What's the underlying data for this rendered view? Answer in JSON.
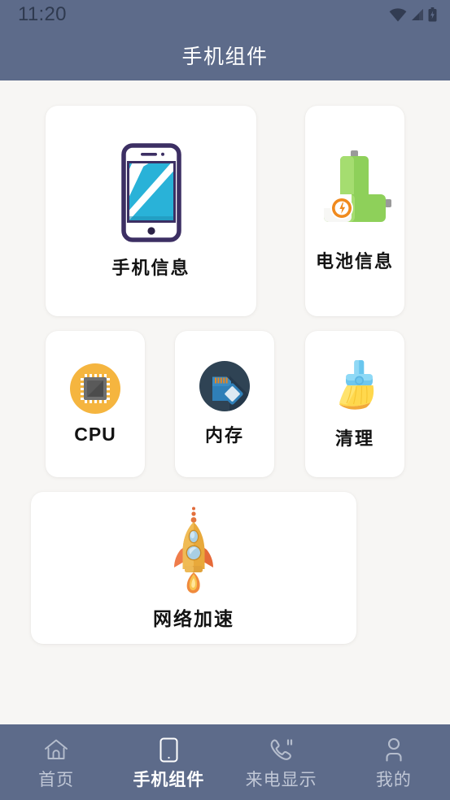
{
  "status_bar": {
    "time": "11:20",
    "icons": [
      "wifi-icon",
      "cellular-signal-icon",
      "battery-charging-icon"
    ]
  },
  "header": {
    "title": "手机组件"
  },
  "theme": {
    "header_bg": "#5D6B8A",
    "page_bg": "#F7F6F4",
    "card_bg": "#FFFFFF",
    "nav_bg": "#5D6B8A",
    "nav_active": "#FFFFFF",
    "nav_inactive": "#C0C7D6",
    "label_color": "#131313"
  },
  "cards": [
    {
      "id": "phone",
      "label": "手机信息",
      "icon": "smartphone-icon"
    },
    {
      "id": "battery",
      "label": "电池信息",
      "icon": "batteries-icon"
    },
    {
      "id": "cpu",
      "label": "CPU",
      "icon": "cpu-chip-icon"
    },
    {
      "id": "memory",
      "label": "内存",
      "icon": "memory-card-icon"
    },
    {
      "id": "clean",
      "label": "清理",
      "icon": "broom-icon"
    },
    {
      "id": "network",
      "label": "网络加速",
      "icon": "rocket-icon"
    }
  ],
  "bottom_nav": {
    "items": [
      {
        "label": "首页",
        "icon": "home-icon",
        "active": false
      },
      {
        "label": "手机组件",
        "icon": "phone-icon",
        "active": true
      },
      {
        "label": "来电显示",
        "icon": "call-icon",
        "active": false
      },
      {
        "label": "我的",
        "icon": "person-icon",
        "active": false
      }
    ]
  }
}
